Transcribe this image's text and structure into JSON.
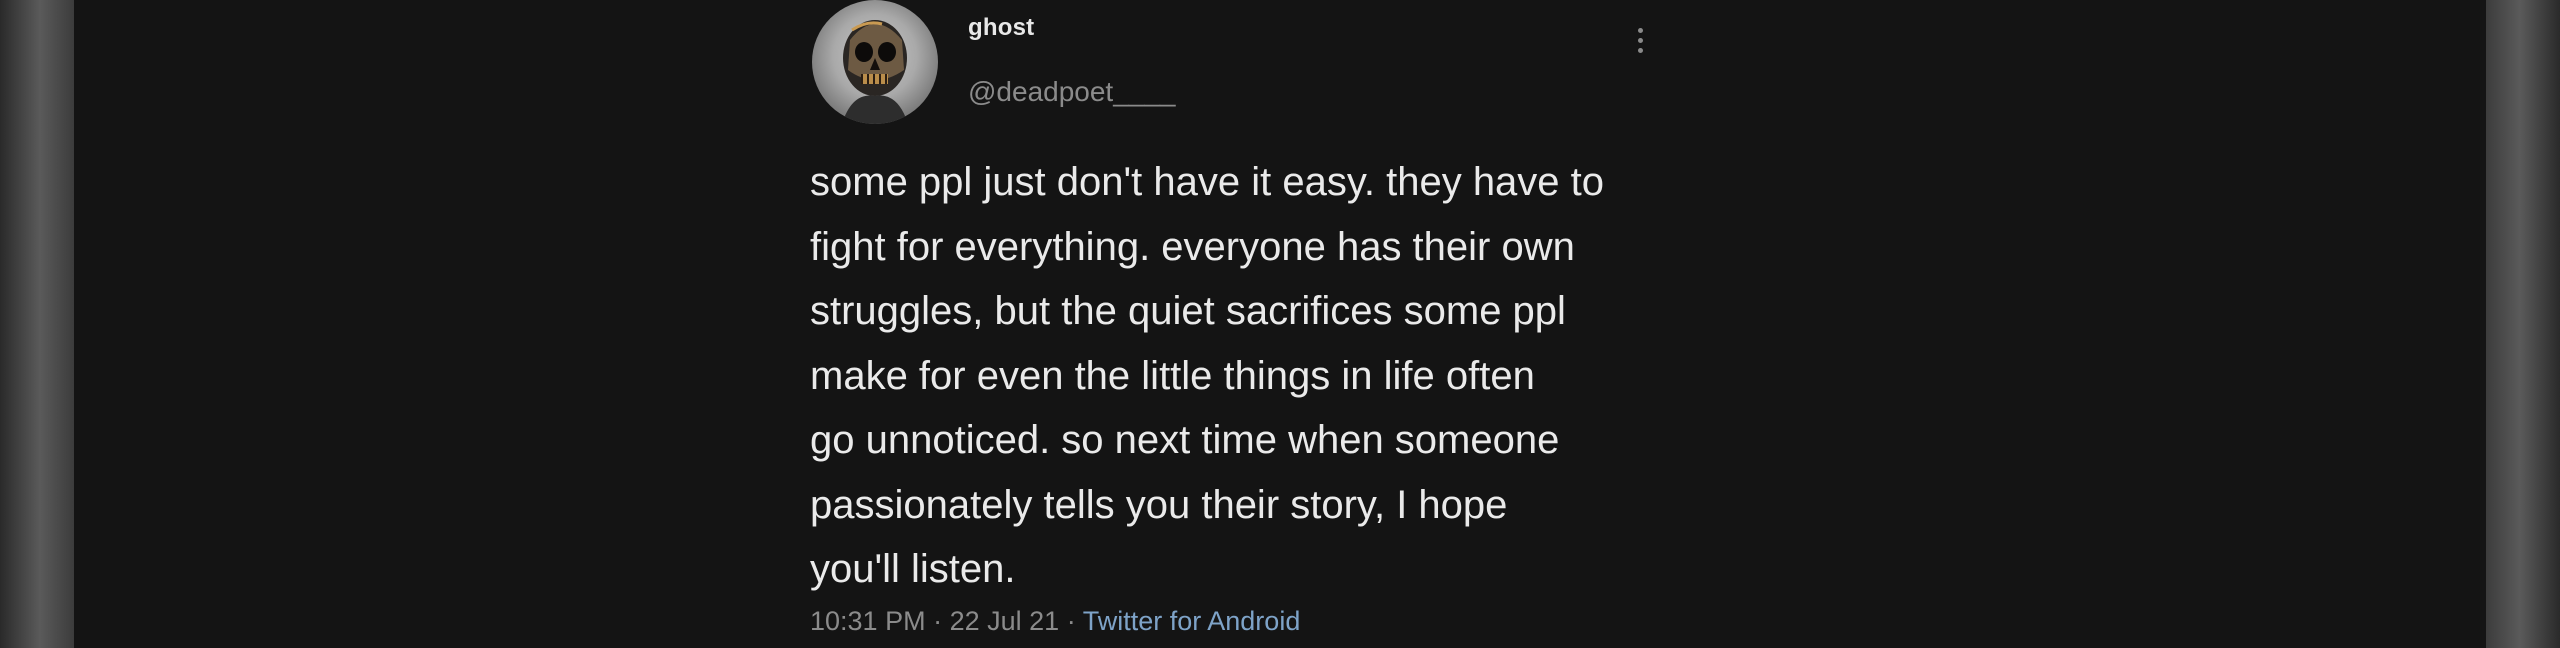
{
  "tweet": {
    "display_name": "ghost",
    "handle": "@deadpoet____",
    "more_icon": "vertical-ellipsis-icon",
    "text_lines": [
      "some ppl just don't have it easy. they have to",
      "fight for everything. everyone has their own",
      "struggles, but the quiet sacrifices some ppl",
      "make for even the little things in life often",
      "go unnoticed. so next time when someone",
      "passionately tells you their story, I hope",
      "you'll listen."
    ],
    "time": "10:31 PM",
    "date": "22 Jul 21",
    "separator": "·",
    "source": "Twitter for Android"
  },
  "colors": {
    "background": "#141414",
    "text": "#eaeaea",
    "muted": "#8b8b8b",
    "link": "#7ea3c8"
  }
}
